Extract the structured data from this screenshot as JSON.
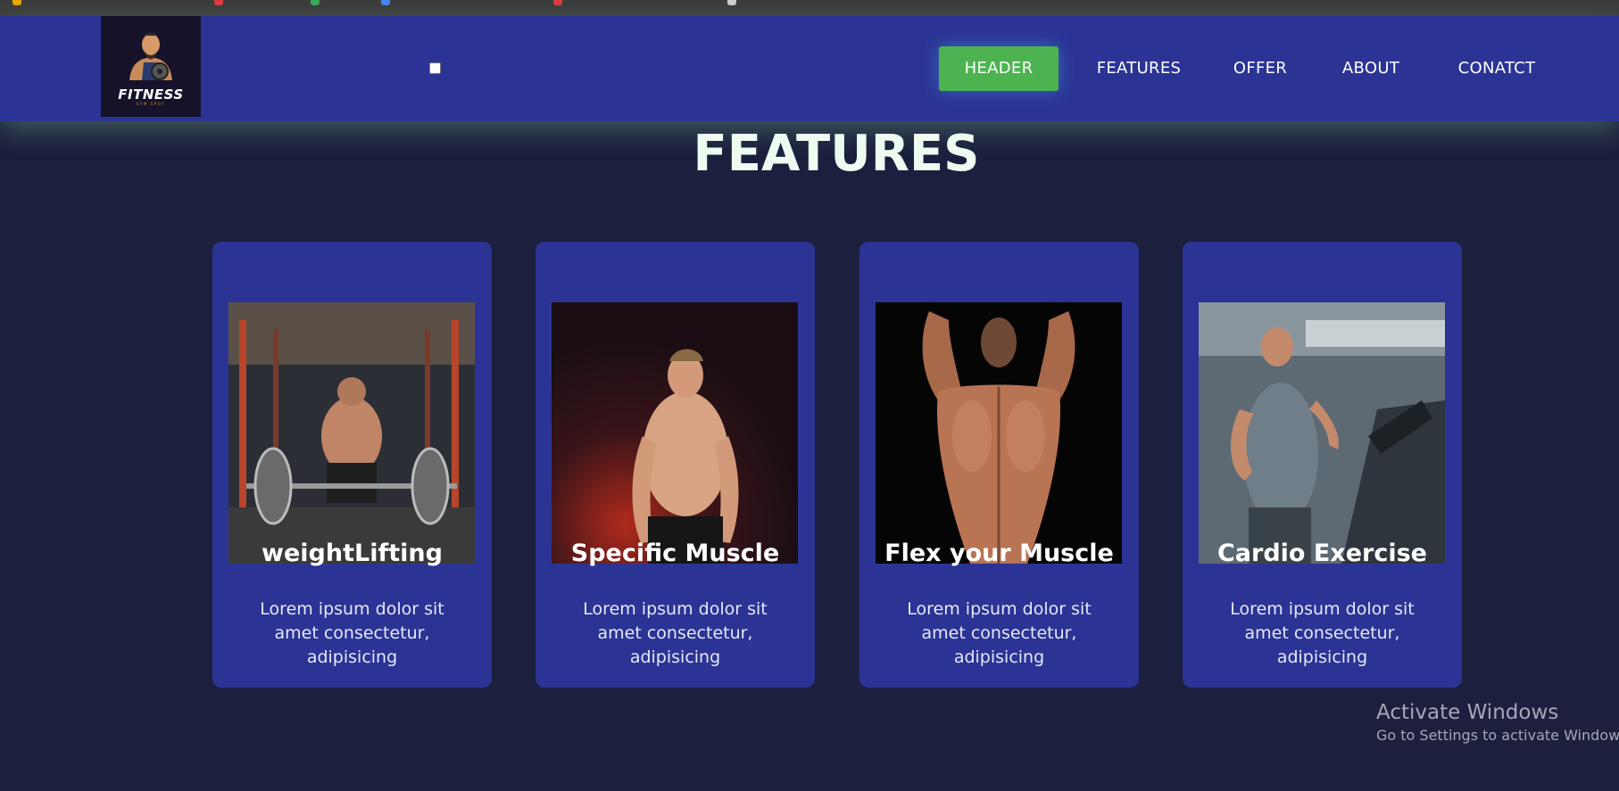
{
  "logo": {
    "brand": "FITNESS",
    "tagline": "GYM SPOT"
  },
  "nav": {
    "items": [
      {
        "label": "HEADER",
        "active": true
      },
      {
        "label": "FEATURES",
        "active": false
      },
      {
        "label": "OFFER",
        "active": false
      },
      {
        "label": "ABOUT",
        "active": false
      },
      {
        "label": "CONATCT",
        "active": false
      }
    ]
  },
  "section": {
    "title": "FEATURES"
  },
  "cards": [
    {
      "title": "weightLifting",
      "text": "Lorem ipsum dolor sit amet consectetur, adipisicing",
      "image_icon": "weightlifter-photo"
    },
    {
      "title": "Specific Muscle",
      "text": "Lorem ipsum dolor sit amet consectetur, adipisicing",
      "image_icon": "muscle-man-photo"
    },
    {
      "title": "Flex your Muscle",
      "text": "Lorem ipsum dolor sit amet consectetur, adipisicing",
      "image_icon": "back-flex-photo"
    },
    {
      "title": "Cardio Exercise",
      "text": "Lorem ipsum dolor sit amet consectetur, adipisicing",
      "image_icon": "treadmill-runner-photo"
    }
  ],
  "watermark": {
    "line1": "Activate Windows",
    "line2": "Go to Settings to activate Windows."
  },
  "colors": {
    "page_bg": "#1c1f3d",
    "navbar_bg": "#2b3494",
    "card_bg": "#2b3494",
    "active_nav": "#4db351",
    "title_color": "#eefbf1"
  }
}
